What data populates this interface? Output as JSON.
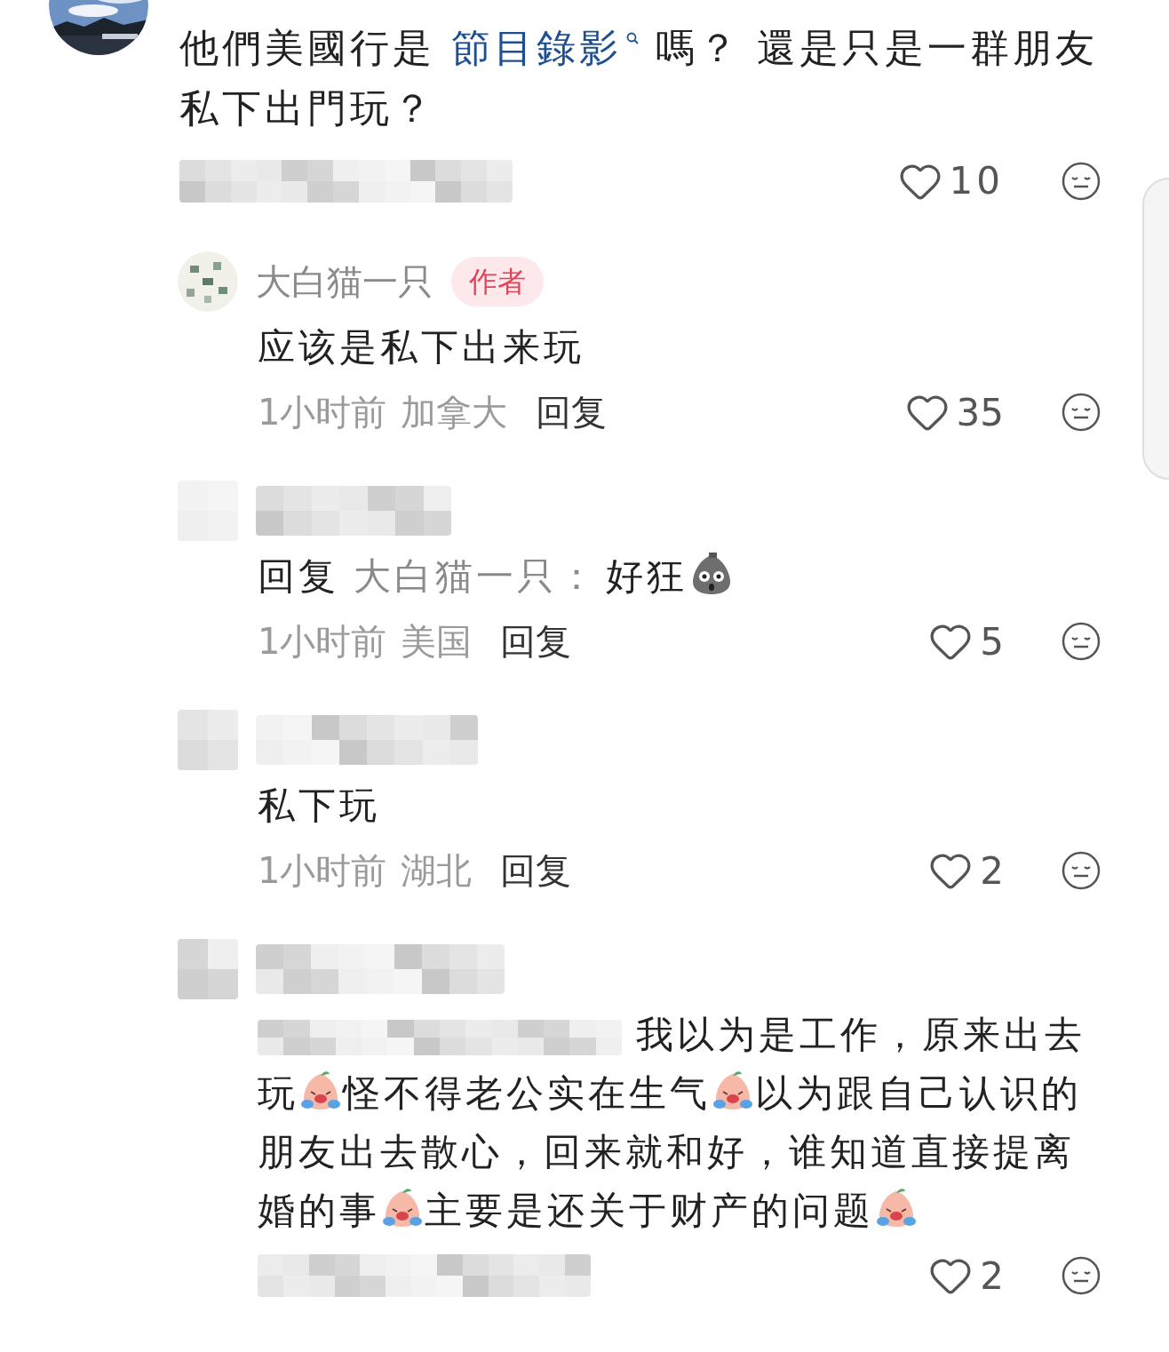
{
  "top_comment": {
    "segments": [
      {
        "kind": "text",
        "text": "他們美國行是 "
      },
      {
        "kind": "link",
        "text": "節目錄影"
      },
      {
        "kind": "text",
        "text": " 嗎？ 還是只是一群朋友私下出門玩？"
      }
    ],
    "likes": "10"
  },
  "replies": [
    {
      "author": "大白猫一只",
      "badge": "作者",
      "segments": [
        {
          "kind": "text",
          "text": "应该是私下出来玩"
        }
      ],
      "time": "1小时前",
      "location": "加拿大",
      "reply": "回复",
      "likes": "35"
    },
    {
      "segments": [
        {
          "kind": "prefix",
          "text": "回复"
        },
        {
          "kind": "mention",
          "text": "大白猫一只："
        },
        {
          "kind": "text",
          "text": "好狂"
        },
        {
          "kind": "shocked"
        }
      ],
      "time": "1小时前",
      "location": "美国",
      "reply": "回复",
      "likes": "5"
    },
    {
      "segments": [
        {
          "kind": "text",
          "text": "私下玩"
        }
      ],
      "time": "1小时前",
      "location": "湖北",
      "reply": "回复",
      "likes": "2"
    },
    {
      "segments": [
        {
          "kind": "hidden"
        },
        {
          "kind": "text",
          "text": "我以为是工作，原来出去玩"
        },
        {
          "kind": "crying"
        },
        {
          "kind": "text",
          "text": "怪不得老公实在生气"
        },
        {
          "kind": "crying"
        },
        {
          "kind": "text",
          "text": "以为跟自己认识的朋友出去散心，回来就和好，谁知道直接提离婚的事"
        },
        {
          "kind": "crying"
        },
        {
          "kind": "text",
          "text": "主要是还关于财产的问题"
        },
        {
          "kind": "crying"
        }
      ],
      "likes": "2"
    }
  ]
}
